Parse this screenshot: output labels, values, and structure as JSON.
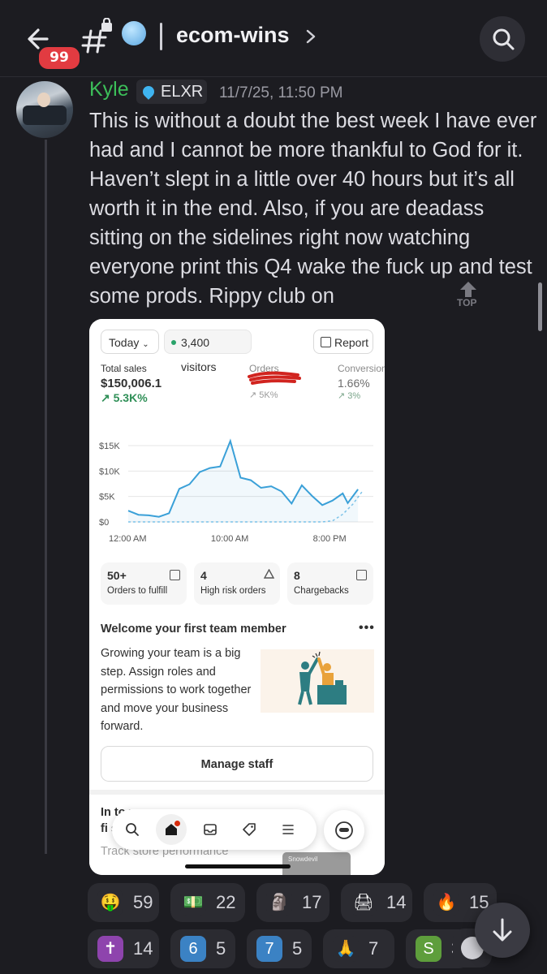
{
  "header": {
    "unread_badge": "99",
    "channel_name": "ecom-wins",
    "icons": [
      "back-arrow-icon",
      "hashtag-lock-icon",
      "cold-face-emoji",
      "chevron-right-icon",
      "search-icon"
    ]
  },
  "message": {
    "author": "Kyle",
    "author_color": "#3cbf59",
    "role_tag": "ELXR",
    "timestamp": "11/7/25, 11:50 PM",
    "text": "This is without a doubt the best week I have ever had and I cannot be more thankful to God for it. Haven’t slept in a little over 40 hours but it’s all worth it in the end. Also, if you are deadass sitting on the sidelines right now watching everyone print this Q4 wake the fuck up and test some prods. Rippy club on",
    "top_label": "TOP"
  },
  "attachment": {
    "filter_label": "Today",
    "visitors_label": "3,400 visitors",
    "report_label": "Report",
    "metrics": [
      {
        "label": "Total sales",
        "value": "$150,006.1",
        "change": "↗ 5.3K%"
      },
      {
        "label": "Orders",
        "value": "",
        "change": "↗ 5K%"
      },
      {
        "label": "Conversion",
        "value": "1.66%",
        "change": "↗ 3%"
      }
    ],
    "chart_data": {
      "type": "line",
      "title": "",
      "xlabel": "",
      "ylabel": "",
      "y_ticks": [
        "$15K",
        "$10K",
        "$5K",
        "$0"
      ],
      "x_ticks": [
        "12:00 AM",
        "10:00 AM",
        "8:00 PM"
      ],
      "ylim": [
        0,
        15000
      ],
      "x_hours": [
        0,
        24
      ],
      "series": [
        {
          "style": "solid",
          "color": "#3aa0d8",
          "points": [
            [
              0,
              2200
            ],
            [
              1,
              1400
            ],
            [
              2,
              1300
            ],
            [
              3,
              1000
            ],
            [
              4,
              1700
            ],
            [
              5,
              6500
            ],
            [
              6,
              7400
            ],
            [
              7,
              9800
            ],
            [
              8,
              10600
            ],
            [
              9,
              10900
            ],
            [
              10,
              15900
            ],
            [
              11,
              8700
            ],
            [
              12,
              8200
            ],
            [
              13,
              6700
            ],
            [
              14,
              7000
            ],
            [
              15,
              6000
            ],
            [
              16,
              3600
            ],
            [
              17,
              7200
            ],
            [
              18,
              5100
            ],
            [
              19,
              3300
            ],
            [
              20,
              4200
            ],
            [
              21,
              5600
            ],
            [
              21.5,
              3700
            ],
            [
              22.5,
              6400
            ]
          ]
        },
        {
          "style": "dashed",
          "color": "#7cc2e8",
          "points": [
            [
              0,
              0
            ],
            [
              19,
              0
            ],
            [
              20,
              200
            ],
            [
              21,
              1500
            ],
            [
              22,
              3500
            ],
            [
              23,
              6200
            ]
          ]
        }
      ]
    },
    "tiles": [
      {
        "value": "50+",
        "label": "Orders to fulfill",
        "icon": "inbox-icon"
      },
      {
        "value": "4",
        "label": "High risk orders",
        "icon": "warning-icon"
      },
      {
        "value": "8",
        "label": "Chargebacks",
        "icon": "clipboard-icon"
      }
    ],
    "team_card": {
      "title": "Welcome your first team member",
      "body": "Growing your team is a big step. Assign roles and permissions to work together and move your business forward.",
      "button": "Manage staff"
    },
    "next_card": {
      "title_fragment": "In      to                            yo",
      "title_fragment2": "fi      s",
      "faded_text": "Track store performance",
      "tooltip": "Snowdevil"
    },
    "nav": [
      "search-icon",
      "home-icon",
      "inbox-icon",
      "tag-icon",
      "menu-icon",
      "sidekick-icon"
    ]
  },
  "reactions": [
    {
      "emoji": "money-mouth-face",
      "glyph": "🤑",
      "count": "59",
      "bg": "#2b2b31"
    },
    {
      "emoji": "cash-stack-custom",
      "glyph": "💵",
      "count": "22",
      "bg": "#2b2b31"
    },
    {
      "emoji": "custom-figure",
      "glyph": "🗿",
      "count": "17",
      "bg": "#2b2b31"
    },
    {
      "emoji": "money-printer-custom",
      "glyph": "🖨",
      "count": "14",
      "bg": "#2b2b31"
    },
    {
      "emoji": "fire-custom",
      "glyph": "🔥",
      "count": "15",
      "bg": "#2b2b31"
    },
    {
      "emoji": "latin-cross",
      "glyph": "✝",
      "count": "14",
      "bg": "#8e44ad"
    },
    {
      "emoji": "keycap-6",
      "glyph": "6",
      "count": "5",
      "bg": "#3b82c4"
    },
    {
      "emoji": "keycap-7",
      "glyph": "7",
      "count": "5",
      "bg": "#3b82c4"
    },
    {
      "emoji": "folded-hands",
      "glyph": "🙏",
      "count": "7",
      "bg": "#2b2b31"
    },
    {
      "emoji": "shopify-bag",
      "glyph": "S",
      "count": "3",
      "bg": "#5e9e3c"
    }
  ]
}
